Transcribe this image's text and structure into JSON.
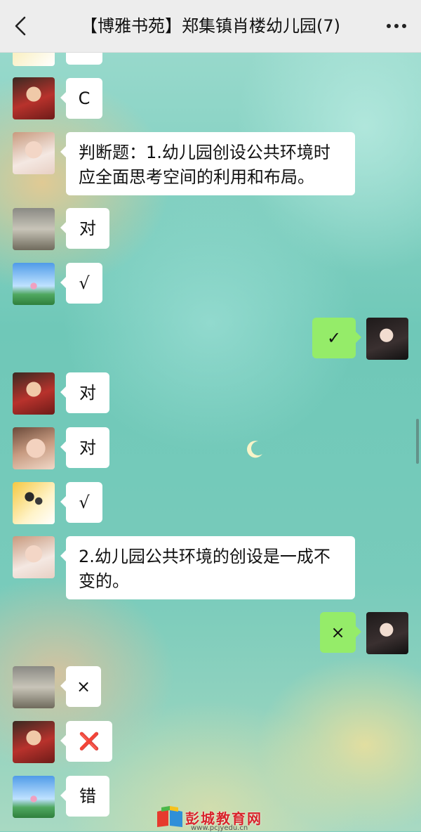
{
  "header": {
    "title": "【博雅书苑】郑集镇肖楼幼儿园(7)",
    "back_icon": "chevron-left-icon",
    "more_icon": "more-dots-icon"
  },
  "messages": [
    {
      "side": "left",
      "avatar": "avatar-child-red",
      "text": "C"
    },
    {
      "side": "left",
      "avatar": "avatar-woman-portrait",
      "text": "判断题：1.幼儿园创设公共环境时应全面思考空间的利用和布局。"
    },
    {
      "side": "left",
      "avatar": "avatar-street-scene",
      "text": "对"
    },
    {
      "side": "left",
      "avatar": "avatar-lotus-sky",
      "text": "√"
    },
    {
      "side": "right",
      "avatar": "avatar-girl-dark",
      "text": "✓"
    },
    {
      "side": "left",
      "avatar": "avatar-child-red",
      "text": "对"
    },
    {
      "side": "left",
      "avatar": "avatar-child-face",
      "text": "对"
    },
    {
      "side": "left",
      "avatar": "avatar-cartoon-family",
      "text": "√"
    },
    {
      "side": "left",
      "avatar": "avatar-woman-portrait",
      "text": "2.幼儿园公共环境的创设是一成不变的。"
    },
    {
      "side": "right",
      "avatar": "avatar-girl-dark",
      "text": "×"
    },
    {
      "side": "left",
      "avatar": "avatar-street-scene",
      "text": "×"
    },
    {
      "side": "left",
      "avatar": "avatar-child-red",
      "text": "❌"
    },
    {
      "side": "left",
      "avatar": "avatar-lotus-sky",
      "text": "错"
    }
  ],
  "watermark": {
    "text": "彭城教育网",
    "sub": "www.pcjyedu.cn"
  },
  "colors": {
    "self_bubble": "#95ec69",
    "other_bubble": "#ffffff",
    "header_bg": "#ededed",
    "cross_red": "#e02020"
  }
}
